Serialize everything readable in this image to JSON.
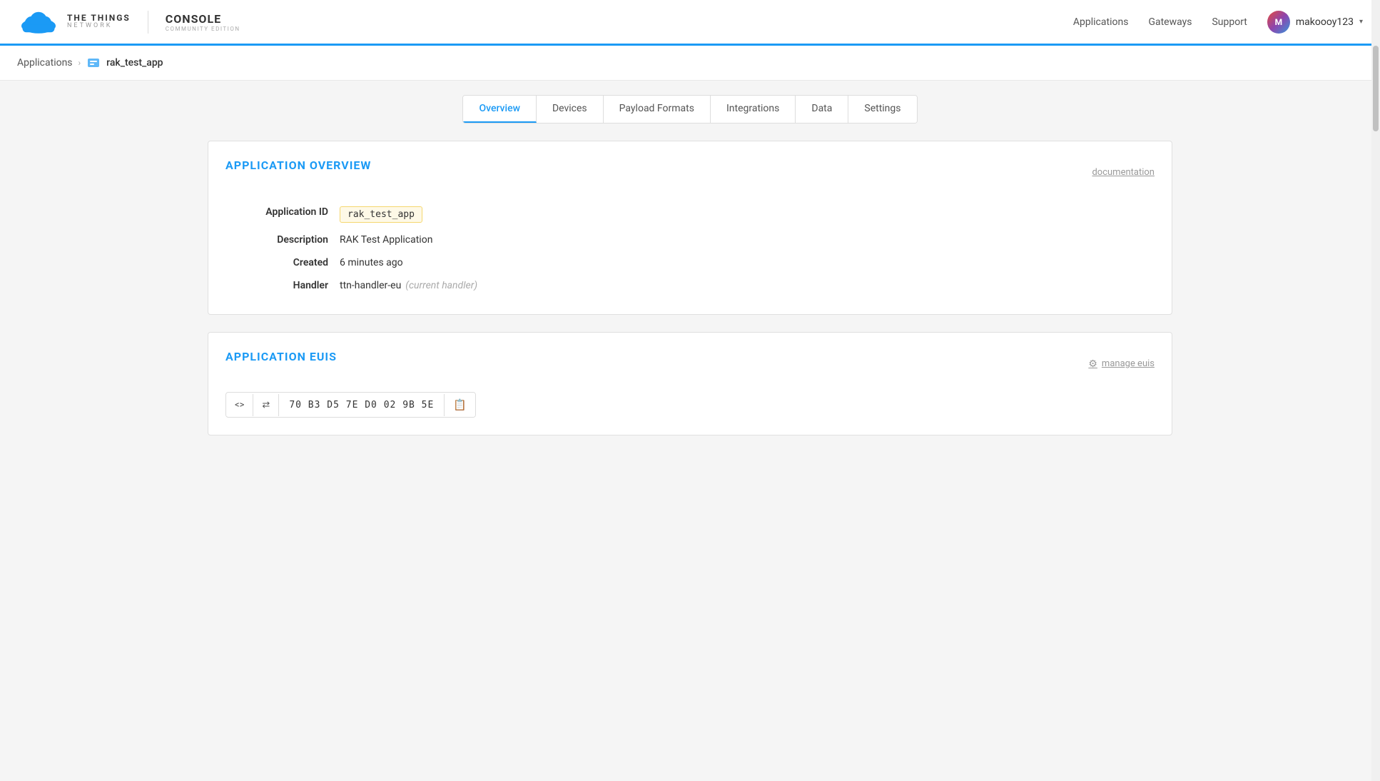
{
  "navbar": {
    "logo_ttn": "THE THINGS",
    "logo_network": "NETWORK",
    "console_title": "CONSOLE",
    "console_subtitle": "COMMUNITY EDITION",
    "nav_links": [
      {
        "label": "Applications",
        "id": "applications"
      },
      {
        "label": "Gateways",
        "id": "gateways"
      },
      {
        "label": "Support",
        "id": "support"
      }
    ],
    "user_name": "makoooy123",
    "user_initials": "M"
  },
  "breadcrumb": {
    "home": "Applications",
    "current": "rak_test_app"
  },
  "tabs": [
    {
      "label": "Overview",
      "id": "overview",
      "active": true
    },
    {
      "label": "Devices",
      "id": "devices",
      "active": false
    },
    {
      "label": "Payload Formats",
      "id": "payload-formats",
      "active": false
    },
    {
      "label": "Integrations",
      "id": "integrations",
      "active": false
    },
    {
      "label": "Data",
      "id": "data",
      "active": false
    },
    {
      "label": "Settings",
      "id": "settings",
      "active": false
    }
  ],
  "overview": {
    "section_title": "APPLICATION OVERVIEW",
    "doc_link": "documentation",
    "fields": [
      {
        "label": "Application ID",
        "value": "rak_test_app",
        "type": "badge"
      },
      {
        "label": "Description",
        "value": "RAK Test Application",
        "type": "text"
      },
      {
        "label": "Created",
        "value": "6 minutes ago",
        "type": "text"
      },
      {
        "label": "Handler",
        "value": "ttn-handler-eu",
        "note": "(current handler)",
        "type": "handler"
      }
    ]
  },
  "euis": {
    "section_title": "APPLICATION EUIS",
    "manage_label": "manage euis",
    "eui_value": "70 B3 D5 7E D0 02 9B 5E",
    "code_icon": "<>",
    "swap_icon": "⇄",
    "copy_icon": "📋"
  }
}
